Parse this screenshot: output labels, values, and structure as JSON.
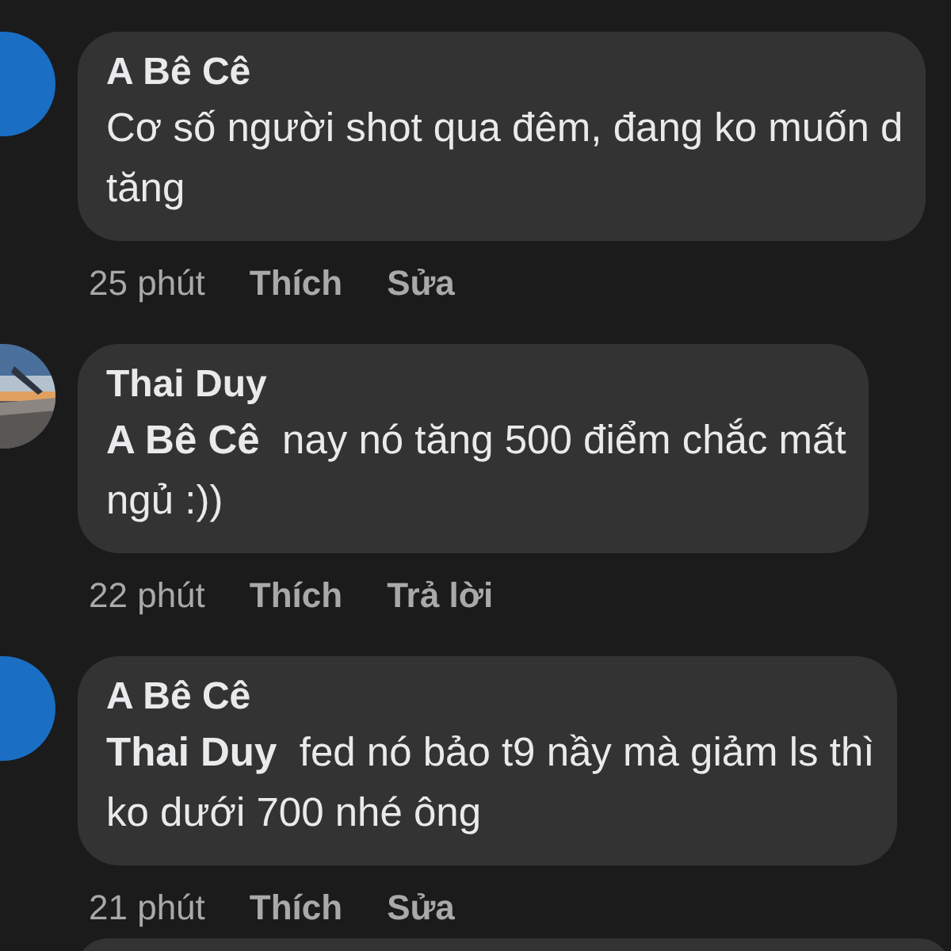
{
  "comments": [
    {
      "kind": "letter",
      "author": "A Bê Cê",
      "lines": [
        "Cơ số người shot qua đêm, đang ko muốn d",
        "tăng"
      ],
      "time": "25 phút",
      "actions": [
        "Thích",
        "Sửa"
      ]
    },
    {
      "kind": "picture",
      "author": "Thai Duy",
      "lines": [
        "**A Bê Cê**  nay nó tăng 500 điểm chắc mất",
        "ngủ :))"
      ],
      "time": "22 phút",
      "actions": [
        "Thích",
        "Trả lời"
      ]
    },
    {
      "kind": "letter",
      "author": "A Bê Cê",
      "lines": [
        "**Thai Duy**  fed nó bảo t9 nầy mà giảm ls thì",
        "ko dưới 700 nhé ông"
      ],
      "time": "21 phút",
      "actions": [
        "Thích",
        "Sửa"
      ]
    }
  ]
}
